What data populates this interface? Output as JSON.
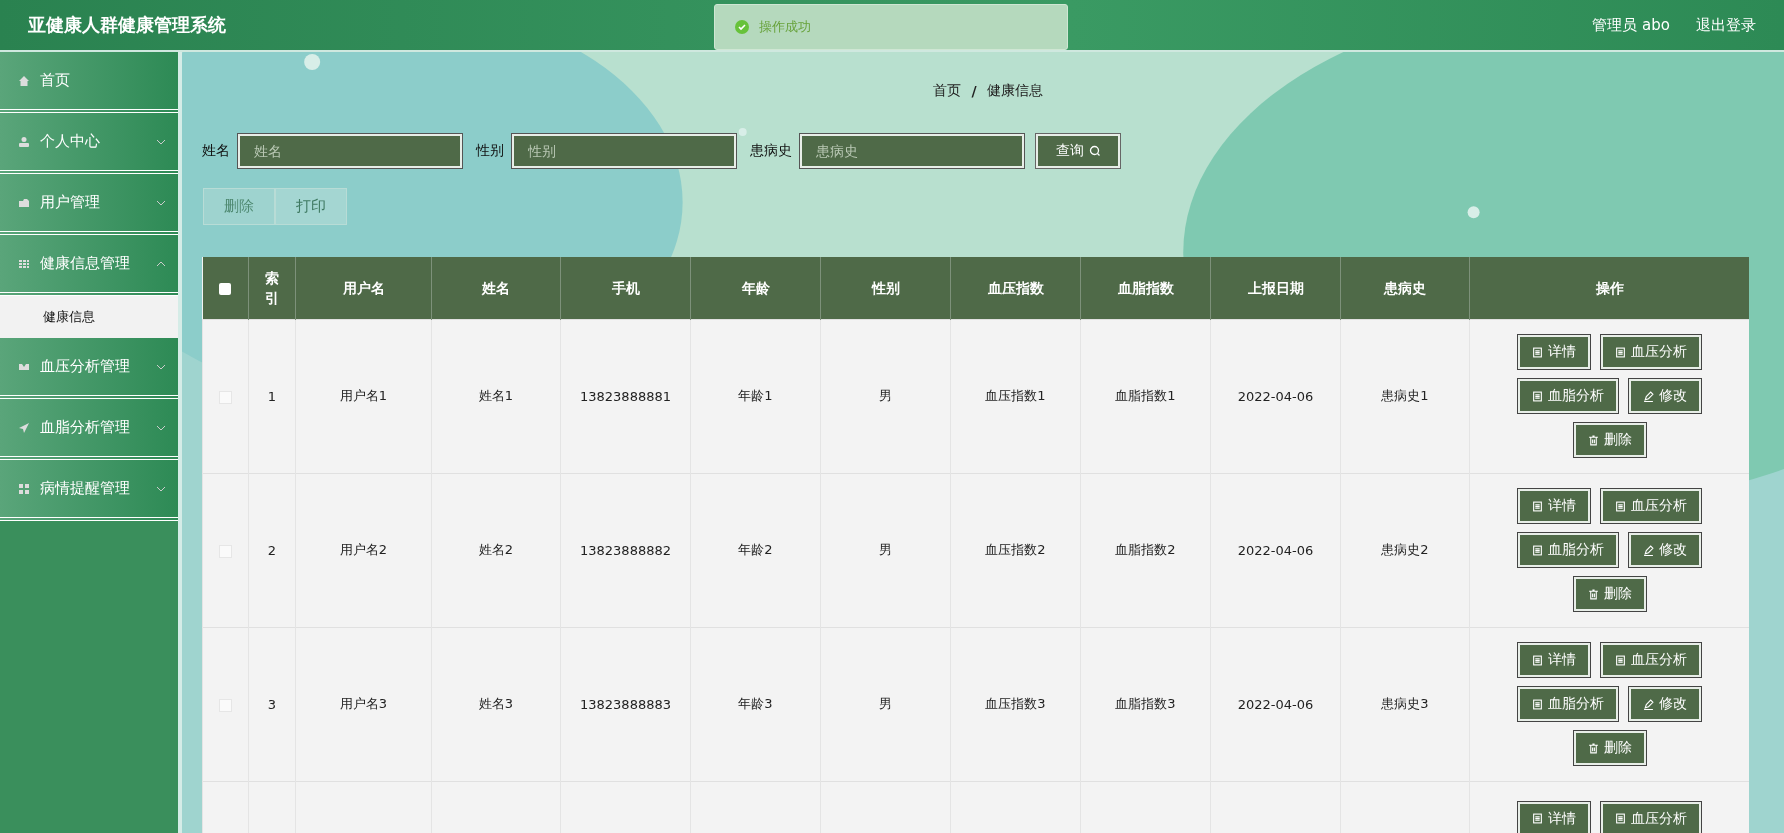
{
  "header": {
    "title": "亚健康人群健康管理系统",
    "user_label": "管理员 abo",
    "logout": "退出登录"
  },
  "toast": {
    "kind": "success",
    "text": "操作成功"
  },
  "sidebar": {
    "items": [
      {
        "label": "首页"
      },
      {
        "label": "个人中心",
        "expanded": false
      },
      {
        "label": "用户管理",
        "expanded": false
      },
      {
        "label": "健康信息管理",
        "expanded": true,
        "children": [
          {
            "label": "健康信息",
            "selected": true
          }
        ]
      },
      {
        "label": "血压分析管理",
        "expanded": false
      },
      {
        "label": "血脂分析管理",
        "expanded": false
      },
      {
        "label": "病情提醒管理",
        "expanded": false
      }
    ]
  },
  "breadcrumb": {
    "items": [
      "首页",
      "健康信息"
    ],
    "separator": "/"
  },
  "search": {
    "fields": [
      {
        "label": "姓名",
        "placeholder": "姓名"
      },
      {
        "label": "性别",
        "placeholder": "性别"
      },
      {
        "label": "患病史",
        "placeholder": "患病史"
      }
    ],
    "button": "查询"
  },
  "toolbar": [
    {
      "label": "删除",
      "disabled": true
    },
    {
      "label": "打印",
      "disabled": false
    }
  ],
  "table": {
    "select_all_checked": false,
    "columns": [
      "索引",
      "用户名",
      "姓名",
      "手机",
      "年龄",
      "性别",
      "血压指数",
      "血脂指数",
      "上报日期",
      "患病史",
      "操作"
    ],
    "rows": [
      {
        "checked": false,
        "cells": [
          "1",
          "用户名1",
          "姓名1",
          "13823888881",
          "年龄1",
          "男",
          "血压指数1",
          "血脂指数1",
          "2022-04-06",
          "患病史1"
        ],
        "actions": [
          {
            "kind": "doc",
            "label": "详情"
          },
          {
            "kind": "doc",
            "label": "血压分析"
          },
          {
            "kind": "doc",
            "label": "血脂分析"
          },
          {
            "kind": "edit",
            "label": "修改"
          },
          {
            "kind": "trash",
            "label": "删除"
          }
        ]
      },
      {
        "checked": false,
        "cells": [
          "2",
          "用户名2",
          "姓名2",
          "13823888882",
          "年龄2",
          "男",
          "血压指数2",
          "血脂指数2",
          "2022-04-06",
          "患病史2"
        ],
        "actions": [
          {
            "kind": "doc",
            "label": "详情"
          },
          {
            "kind": "doc",
            "label": "血压分析"
          },
          {
            "kind": "doc",
            "label": "血脂分析"
          },
          {
            "kind": "edit",
            "label": "修改"
          },
          {
            "kind": "trash",
            "label": "删除"
          }
        ]
      },
      {
        "checked": false,
        "cells": [
          "3",
          "用户名3",
          "姓名3",
          "13823888883",
          "年龄3",
          "男",
          "血压指数3",
          "血脂指数3",
          "2022-04-06",
          "患病史3"
        ],
        "actions": [
          {
            "kind": "doc",
            "label": "详情"
          },
          {
            "kind": "doc",
            "label": "血压分析"
          },
          {
            "kind": "doc",
            "label": "血脂分析"
          },
          {
            "kind": "edit",
            "label": "修改"
          },
          {
            "kind": "trash",
            "label": "删除"
          }
        ]
      },
      {
        "cells": [],
        "actions": [
          {
            "kind": "doc",
            "label": "详情"
          },
          {
            "kind": "doc",
            "label": "血压分析"
          }
        ]
      }
    ]
  }
}
